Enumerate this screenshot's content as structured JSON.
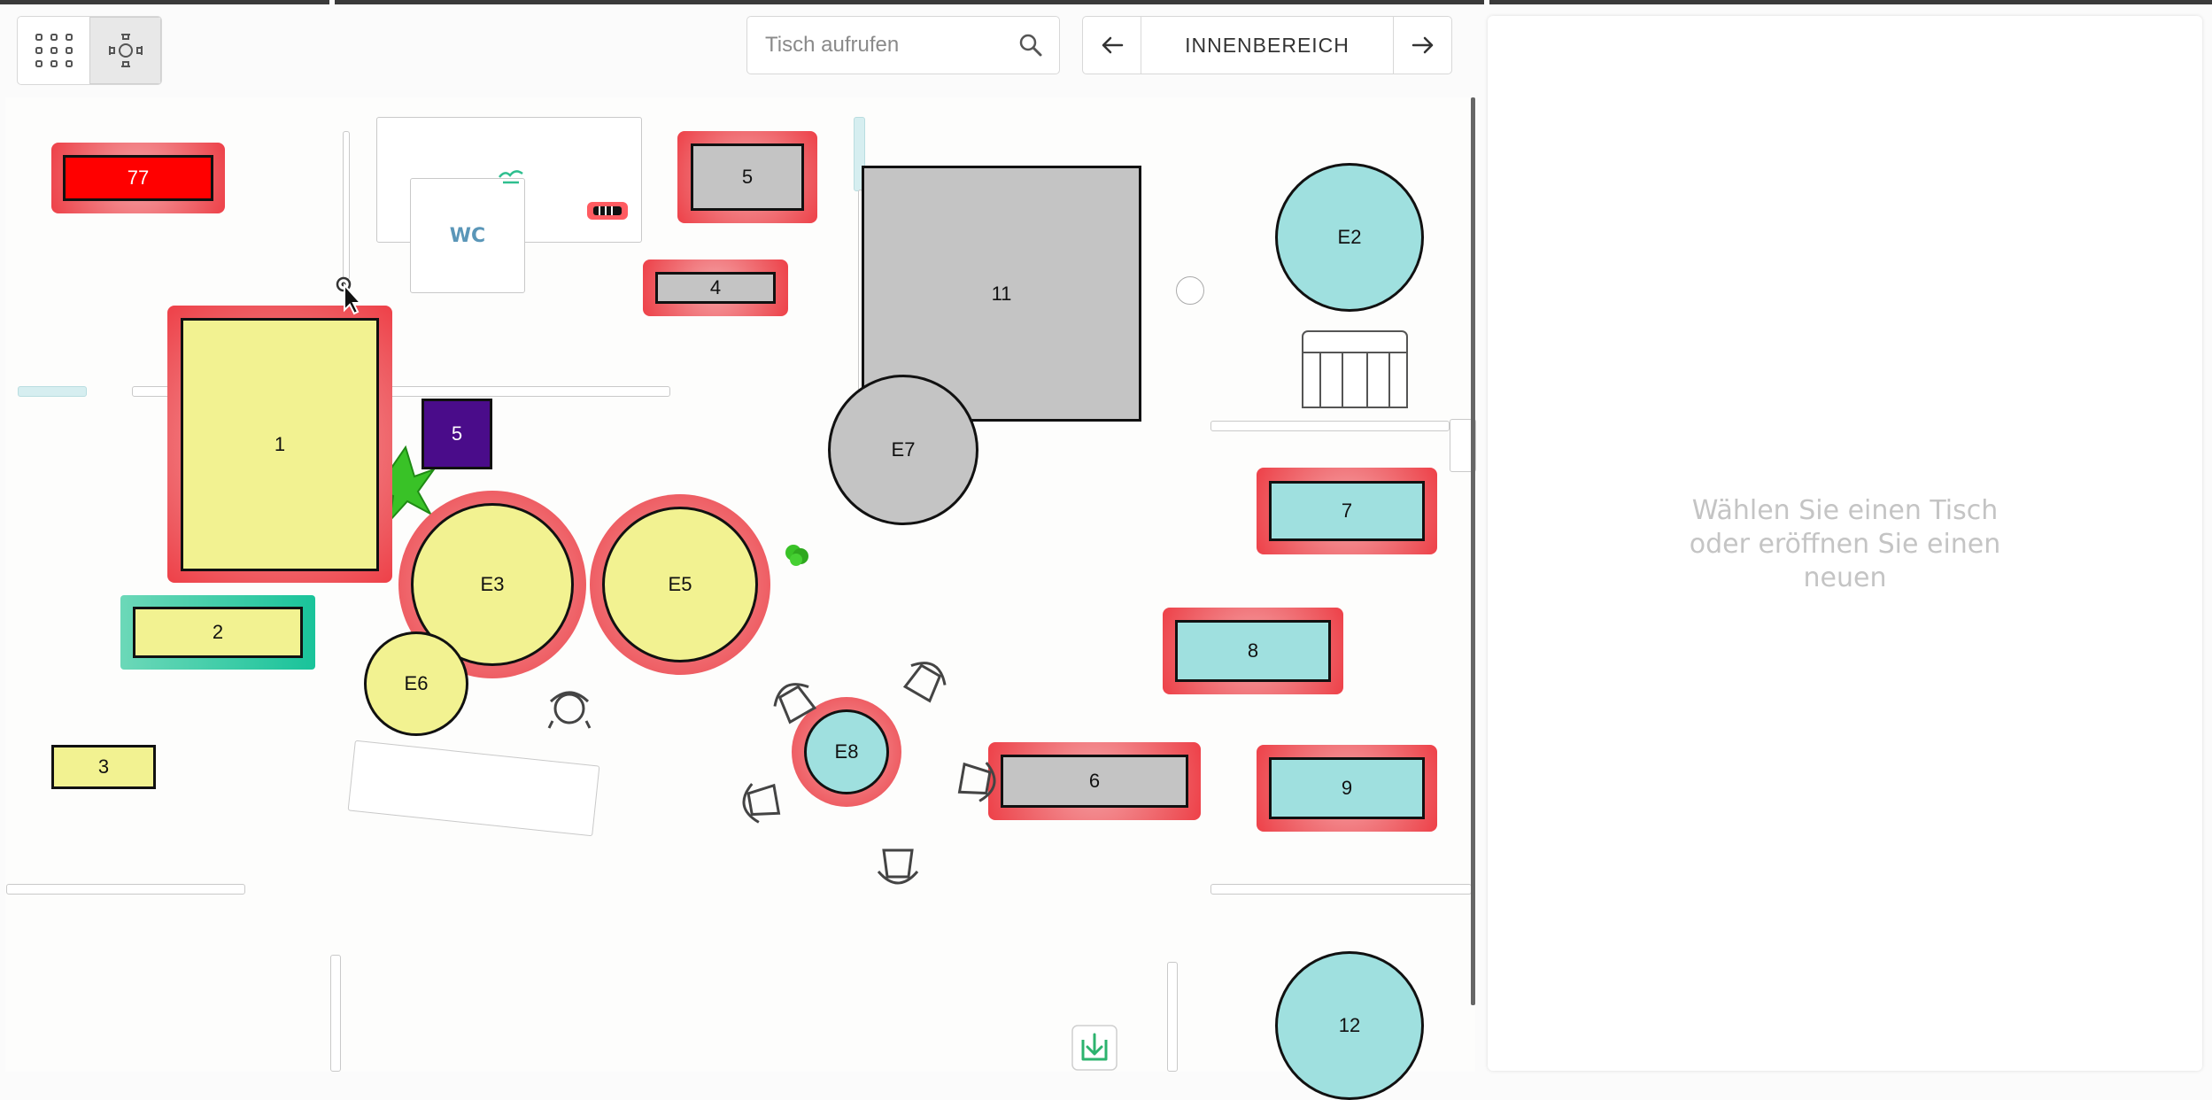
{
  "toolbar": {
    "grid_icon": "grid-icon",
    "floorplan_icon": "floorplan-icon",
    "search": {
      "placeholder": "Tisch aufrufen",
      "value": "",
      "icon": "search-icon"
    },
    "area": {
      "label": "INNENBEREICH",
      "prev_icon": "arrow-left-icon",
      "next_icon": "arrow-right-icon"
    }
  },
  "floorplan": {
    "wc_label": "WC",
    "tables": [
      {
        "id": "t77",
        "label": "77",
        "status": "occupied",
        "fill": "#ff0000"
      },
      {
        "id": "t5a",
        "label": "5",
        "status": "occupied",
        "fill": "#c4c4c4"
      },
      {
        "id": "t4",
        "label": "4",
        "status": "occupied",
        "fill": "#c4c4c4"
      },
      {
        "id": "t11",
        "label": "11",
        "status": "free",
        "fill": "#c4c4c4"
      },
      {
        "id": "tE2",
        "label": "E2",
        "status": "free",
        "fill": "#9fe0df"
      },
      {
        "id": "t1",
        "label": "1",
        "status": "occupied",
        "fill": "#f2f291"
      },
      {
        "id": "t5b",
        "label": "5",
        "status": "free",
        "fill": "#4a0c8a"
      },
      {
        "id": "tE7",
        "label": "E7",
        "status": "free",
        "fill": "#c4c4c4"
      },
      {
        "id": "t7",
        "label": "7",
        "status": "occupied",
        "fill": "#9fe0df"
      },
      {
        "id": "tE3",
        "label": "E3",
        "status": "occupied",
        "fill": "#f2f291"
      },
      {
        "id": "tE5",
        "label": "E5",
        "status": "occupied",
        "fill": "#f2f291"
      },
      {
        "id": "t2",
        "label": "2",
        "status": "selected",
        "fill": "#f2f291"
      },
      {
        "id": "t8",
        "label": "8",
        "status": "occupied",
        "fill": "#9fe0df"
      },
      {
        "id": "tE6",
        "label": "E6",
        "status": "free",
        "fill": "#f2f291"
      },
      {
        "id": "tE8",
        "label": "E8",
        "status": "occupied",
        "fill": "#9fe0df"
      },
      {
        "id": "t6",
        "label": "6",
        "status": "occupied",
        "fill": "#c4c4c4"
      },
      {
        "id": "t9",
        "label": "9",
        "status": "occupied",
        "fill": "#9fe0df"
      },
      {
        "id": "t3",
        "label": "3",
        "status": "free",
        "fill": "#f2f291"
      },
      {
        "id": "t12",
        "label": "12",
        "status": "free",
        "fill": "#9fe0df"
      }
    ]
  },
  "detail_panel": {
    "empty_line1": "Wählen Sie einen Tisch",
    "empty_line2": "oder eröffnen Sie einen",
    "empty_line3": "neuen"
  },
  "colors": {
    "occupied_halo": "#ee4048",
    "selected_halo": "#19c39a",
    "table_border": "#111111"
  }
}
